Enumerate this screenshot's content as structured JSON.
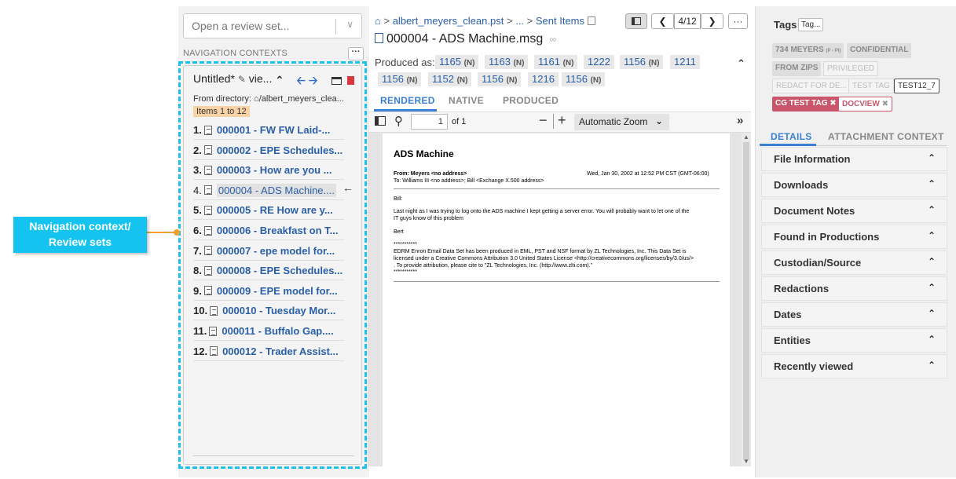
{
  "annotation": {
    "callout_text_1": "Navigation context/",
    "callout_text_2": "Review sets"
  },
  "left": {
    "open_placeholder": "Open a review set...",
    "nav_contexts_label": "NAVIGATION CONTEXTS",
    "more_label": "···",
    "context_title": "Untitled*",
    "context_view": "vie...",
    "from_directory_label": "From directory:",
    "from_directory_path": "/albert_meyers_clea...",
    "items_range": "Items 1 to 12",
    "items": [
      {
        "num": "1.",
        "text": "000001 - FW  FW  Laid-..."
      },
      {
        "num": "2.",
        "text": "000002 - EPE Schedules..."
      },
      {
        "num": "3.",
        "text": "000003 - How are you ..."
      },
      {
        "num": "4.",
        "text": "000004 - ADS Machine...."
      },
      {
        "num": "5.",
        "text": "000005 - RE  How are y..."
      },
      {
        "num": "6.",
        "text": "000006 - Breakfast on T..."
      },
      {
        "num": "7.",
        "text": "000007 - epe model for..."
      },
      {
        "num": "8.",
        "text": "000008 - EPE Schedules..."
      },
      {
        "num": "9.",
        "text": "000009 - EPE model for..."
      },
      {
        "num": "10.",
        "text": "000010 - Tuesday Mor..."
      },
      {
        "num": "11.",
        "text": "000011 - Buffalo Gap...."
      },
      {
        "num": "12.",
        "text": "000012 - Trader Assist..."
      }
    ]
  },
  "middle": {
    "breadcrumb": {
      "path1": "albert_meyers_clean.pst",
      "sep": ">",
      "ellipsis": "...",
      "path2": "Sent Items"
    },
    "doc_title": "000004 - ADS Machine.msg",
    "pager": "4/12",
    "more_label": "···",
    "produced_label": "Produced as:",
    "produced": [
      {
        "id": "1165",
        "flag": "(N)"
      },
      {
        "id": "1163",
        "flag": "(N)"
      },
      {
        "id": "1161",
        "flag": "(N)"
      },
      {
        "id": "1222",
        "flag": ""
      },
      {
        "id": "1156",
        "flag": "(N)"
      },
      {
        "id": "1211",
        "flag": ""
      },
      {
        "id": "1156",
        "flag": "(N)"
      },
      {
        "id": "1152",
        "flag": "(N)"
      },
      {
        "id": "1156",
        "flag": "(N)"
      },
      {
        "id": "1216",
        "flag": ""
      },
      {
        "id": "1156",
        "flag": "(N)"
      }
    ],
    "tabs": [
      "RENDERED",
      "NATIVE",
      "PRODUCED"
    ],
    "page_number": "1",
    "page_of": "of 1",
    "zoom": "Automatic Zoom",
    "email": {
      "heading": "ADS Machine",
      "from": "From: Meyers <no address>",
      "date": "Wed, Jan 30, 2002 at 12:52 PM CST (GMT-06:00)",
      "to": "To: Williams III <no address>; Bill <Exchange X.500 address>",
      "greeting": "Bill:",
      "body1": "Last night as I was trying to log onto the ADS machine I kept getting a server error.  You will probably want to let one of the",
      "body2": "IT guys know of this problem",
      "sign": "Bert",
      "stars": "***********",
      "footer1": "EDRM Enron Email Data Set has been produced in EML, PST and NSF format by ZL Technologies, Inc. This Data Set is",
      "footer2": "licensed under a Creative Commons Attribution 3.0 United States License <http://creativecommons.org/licenses/by/3.0/us/>",
      "footer3": ". To provide attribution, please cite to \"ZL Technologies, Inc. (http://www.zlti.com).\"",
      "stars2": "***********"
    }
  },
  "right": {
    "tags_label": "Tags",
    "tag_input": "Tag...",
    "tags": [
      "734 MEYERS",
      "CONFIDENTIAL",
      "FROM ZIPS",
      "PRIVILEGED",
      "REDACT FOR DE...",
      "TEST TAG",
      "TEST12_7",
      "CG TEST TAG",
      "DOCVIEW"
    ],
    "tag_suffix": "(P - PI)",
    "tabs": [
      "DETAILS",
      "ATTACHMENT CONTEXT"
    ],
    "sections": [
      "File Information",
      "Downloads",
      "Document Notes",
      "Found in Productions",
      "Custodian/Source",
      "Redactions",
      "Dates",
      "Entities",
      "Recently viewed"
    ]
  }
}
